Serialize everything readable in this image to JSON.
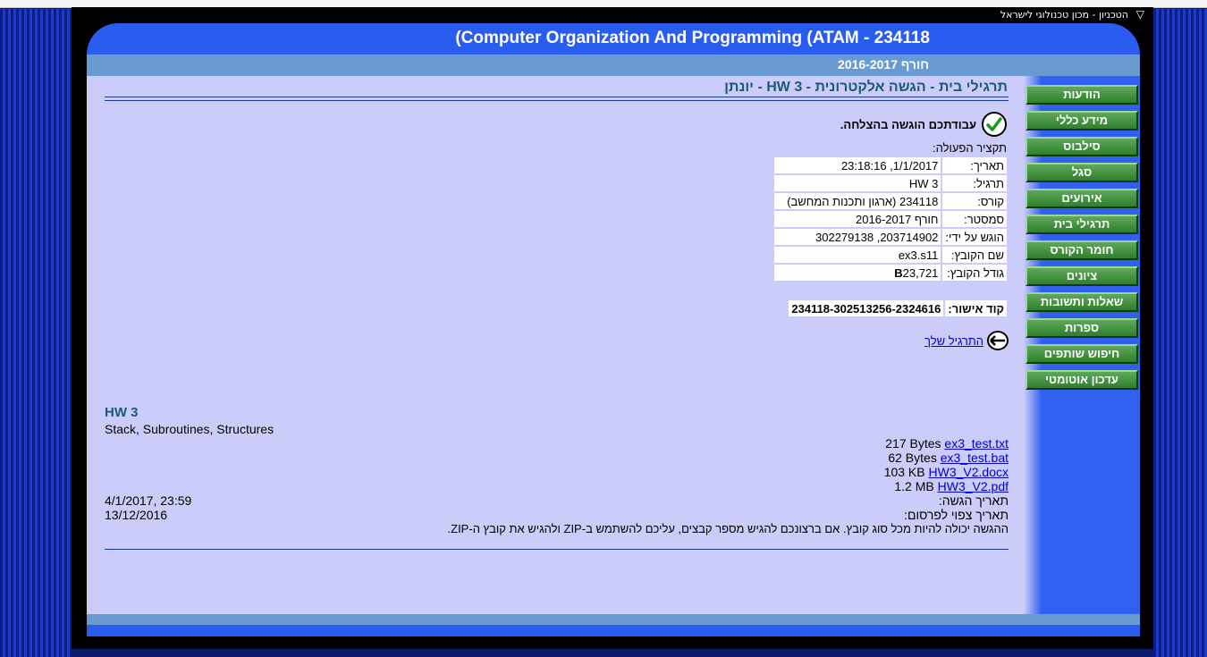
{
  "header": {
    "technion": "הטכניון - מכון טכנולוגי לישראל",
    "course_title": "(Computer Organization And Programming (ATAM - 234118",
    "semester": "חורף 2016-2017"
  },
  "nav": {
    "items": [
      {
        "label": "הודעות"
      },
      {
        "label": "מידע כללי"
      },
      {
        "label": "סילבוס"
      },
      {
        "label": "סגל"
      },
      {
        "label": "אירועים"
      },
      {
        "label": "תרגילי בית"
      },
      {
        "label": "חומר הקורס"
      },
      {
        "label": "ציונים"
      },
      {
        "label": "שאלות ותשובות"
      },
      {
        "label": "ספרות"
      },
      {
        "label": "חיפוש שותפים"
      },
      {
        "label": "עדכון אוטומטי"
      }
    ]
  },
  "main": {
    "heading": "תרגילי בית - הגשה אלקטרונית - HW 3 - יונתן",
    "success_message": "עבודתכם הוגשה בהצלחה.",
    "summary_label": "תקציר הפעולה:",
    "details": [
      {
        "label": "תאריך:",
        "value": "1/1/2017, 23:18:16"
      },
      {
        "label": "תרגיל:",
        "value": "HW 3"
      },
      {
        "label": "קורס:",
        "value": "234118 (ארגון ותכנות המחשב)"
      },
      {
        "label": "סמסטר:",
        "value": "חורף 2016-2017"
      },
      {
        "label": "הוגש על ידי:",
        "value": "203714902, 302279138"
      },
      {
        "label": "שם הקובץ:",
        "value": "ex3.s11"
      },
      {
        "label": "גודל הקובץ:",
        "value": "23,721",
        "value_bold": "B"
      }
    ],
    "approval_label": "קוד אישור:",
    "approval_code": "234118-302513256-2324616",
    "next_link": "התרגיל שלך"
  },
  "homework": {
    "title": "HW 3",
    "description": "Stack, Subroutines, Structures",
    "files": [
      {
        "size": "217 Bytes",
        "name": "ex3_test.txt"
      },
      {
        "size": "62 Bytes",
        "name": "ex3_test.bat"
      },
      {
        "size": "103 KB",
        "name": "HW3_V2.docx"
      },
      {
        "size": "1.2 MB",
        "name": "HW3_V2.pdf"
      }
    ],
    "due_label": "תאריך הגשה:",
    "due_value": "4/1/2017, 23:59",
    "publish_label": "תאריך צפוי לפרסום:",
    "publish_value": "13/12/2016",
    "note": "ההגשה יכולה להיות מכל סוג קובץ. אם ברצונכם להגיש מספר קבצים, עליכם להשתמש ב-ZIP ולהגיש את קובץ ה-ZIP."
  }
}
